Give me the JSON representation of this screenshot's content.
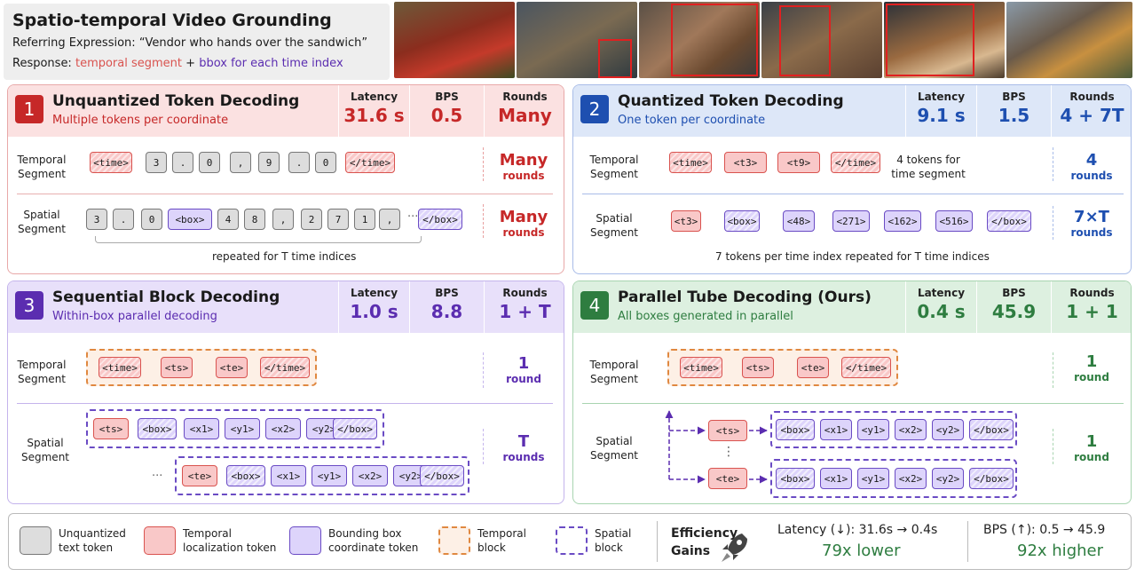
{
  "header": {
    "title": "Spatio-temporal Video Grounding",
    "ref_prefix": "Referring Expression:",
    "ref_text": "“Vendor who hands over the sandwich”",
    "resp_prefix": "Response:",
    "resp_temporal": "temporal segment",
    "resp_plus": "+",
    "resp_bbox": "bbox for each time index"
  },
  "colors": {
    "red": "#c62828",
    "blue": "#1e4fb0",
    "purple": "#5b2db0",
    "green": "#2e7d40"
  },
  "metric_labels": {
    "latency": "Latency",
    "bps": "BPS",
    "rounds": "Rounds"
  },
  "row_labels": {
    "temporal": "Temporal Segment",
    "spatial": "Spatial Segment"
  },
  "panel1": {
    "num": "1",
    "title": "Unquantized Token Decoding",
    "subtitle": "Multiple tokens per coordinate",
    "latency": "31.6 s",
    "bps": "0.5",
    "rounds": "Many",
    "temporal_tokens": [
      "<time>",
      "3",
      ".",
      "0",
      ",",
      "9",
      ".",
      "0",
      "</time>"
    ],
    "spatial_tokens": [
      "3",
      ".",
      "0",
      "<box>",
      "4",
      "8",
      ",",
      "2",
      "7",
      "1",
      ","
    ],
    "ellipsis": "···",
    "spatial_end": "</box>",
    "r_temporal_big": "Many",
    "r_temporal_sm": "rounds",
    "r_spatial_big": "Many",
    "r_spatial_sm": "rounds",
    "note": "repeated for T time indices"
  },
  "panel2": {
    "num": "2",
    "title": "Quantized Token Decoding",
    "subtitle": "One token per coordinate",
    "latency": "9.1 s",
    "bps": "1.5",
    "rounds": "4 + 7T",
    "temporal_tokens": [
      "<time>",
      "<t3>",
      "<t9>",
      "</time>"
    ],
    "temporal_note": "4 tokens for time segment",
    "spatial_tokens": [
      "<t3>",
      "<box>",
      "<48>",
      "<271>",
      "<162>",
      "<516>",
      "</box>"
    ],
    "r_temporal_big": "4",
    "r_temporal_sm": "rounds",
    "r_spatial_big": "7×T",
    "r_spatial_sm": "rounds",
    "note": "7 tokens per time index repeated for T time indices"
  },
  "panel3": {
    "num": "3",
    "title": "Sequential Block Decoding",
    "subtitle": "Within-box parallel decoding",
    "latency": "1.0 s",
    "bps": "8.8",
    "rounds": "1 + T",
    "temporal_tokens": [
      "<time>",
      "<ts>",
      "<te>",
      "</time>"
    ],
    "spatial_row1": [
      "<ts>",
      "<box>",
      "<x1>",
      "<y1>",
      "<x2>",
      "<y2>",
      "</box>"
    ],
    "spatial_row2": [
      "<te>",
      "<box>",
      "<x1>",
      "<y1>",
      "<x2>",
      "<y2>",
      "</box>"
    ],
    "ellipsis": "···",
    "r_temporal_big": "1",
    "r_temporal_sm": "round",
    "r_spatial_big": "T",
    "r_spatial_sm": "rounds"
  },
  "panel4": {
    "num": "4",
    "title": "Parallel Tube Decoding (Ours)",
    "subtitle": "All boxes generated in parallel",
    "latency": "0.4 s",
    "bps": "45.9",
    "rounds": "1 + 1",
    "temporal_tokens": [
      "<time>",
      "<ts>",
      "<te>",
      "</time>"
    ],
    "spatial_start1": "<ts>",
    "spatial_start2": "<te>",
    "vdots": "⋮",
    "spatial_box": [
      "<box>",
      "<x1>",
      "<y1>",
      "<x2>",
      "<y2>",
      "</box>"
    ],
    "r_temporal_big": "1",
    "r_temporal_sm": "round",
    "r_spatial_big": "1",
    "r_spatial_sm": "round"
  },
  "legend": {
    "items": [
      {
        "label": "Unquantized text token",
        "kind": "gray"
      },
      {
        "label": "Temporal localization token",
        "kind": "temporal"
      },
      {
        "label": "Bounding box coordinate token",
        "kind": "box"
      },
      {
        "label": "Temporal block",
        "kind": "temporal-block"
      },
      {
        "label": "Spatial block",
        "kind": "spatial-block"
      }
    ],
    "gains_title": "Efficiency Gains",
    "latency_line": "Latency (↓): 31.6s → 0.4s",
    "latency_gain": "79x lower",
    "bps_line": "BPS (↑): 0.5 → 45.9",
    "bps_gain": "92x higher",
    "rocket_icon": "rocket-icon"
  }
}
